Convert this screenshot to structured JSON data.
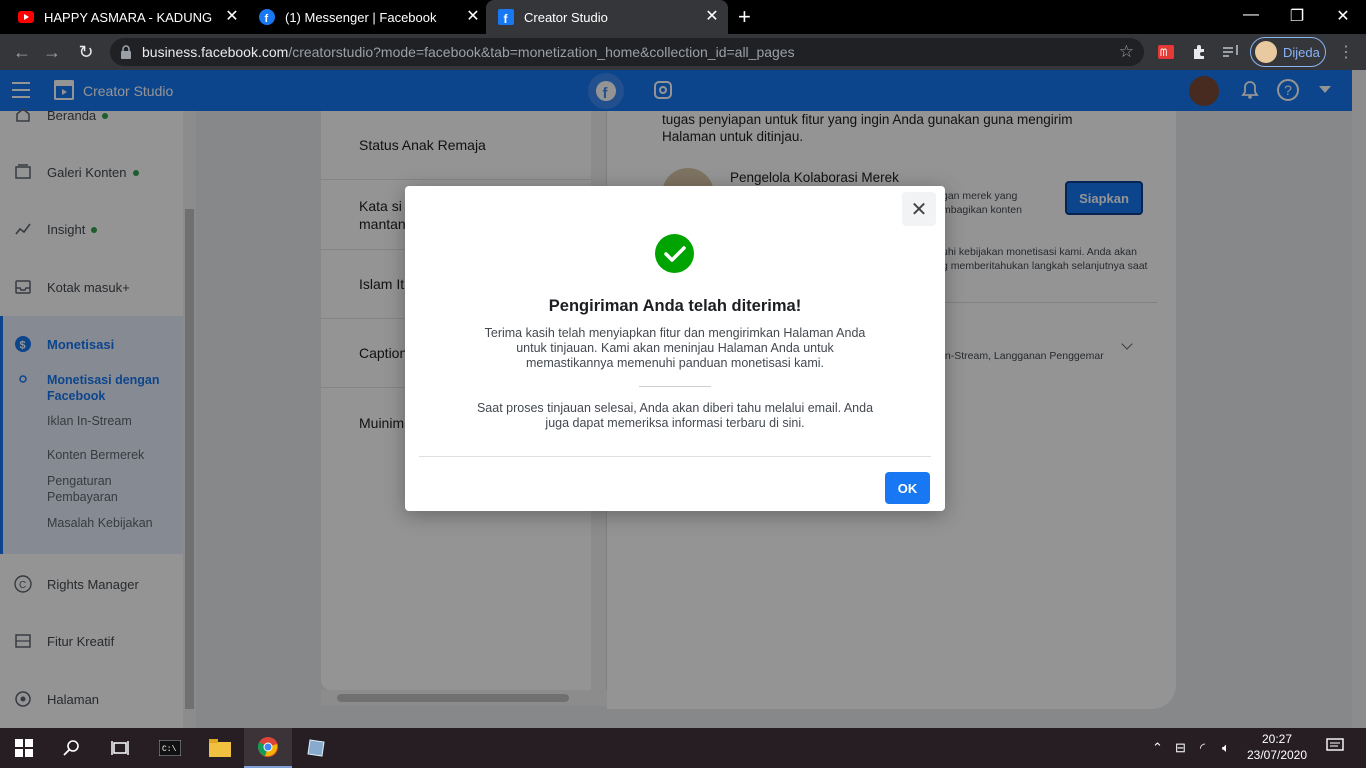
{
  "browser": {
    "tabs": [
      {
        "title": "HAPPY ASMARA - KADUNG JERU",
        "icon": "youtube-icon"
      },
      {
        "title": "(1) Messenger | Facebook",
        "icon": "facebook-icon"
      },
      {
        "title": "Creator Studio",
        "icon": "facebook-icon",
        "active": true
      }
    ],
    "url_host": "business.facebook.com",
    "url_path": "/creatorstudio?mode=facebook&tab=monetization_home&collection_id=all_pages",
    "profile_name": "Dijeda"
  },
  "app": {
    "brand": "Creator Studio"
  },
  "sidebar": {
    "items": [
      {
        "label": "Beranda",
        "dot": true,
        "icon": "home-icon"
      },
      {
        "label": "Galeri Konten",
        "dot": true,
        "icon": "gallery-icon"
      },
      {
        "label": "Insight",
        "dot": true,
        "icon": "insight-icon"
      },
      {
        "label": "Kotak masuk+",
        "icon": "inbox-icon"
      },
      {
        "label": "Monetisasi",
        "icon": "dollar-icon"
      },
      {
        "label": "Rights Manager",
        "icon": "copyright-icon"
      },
      {
        "label": "Fitur Kreatif",
        "icon": "creative-icon"
      },
      {
        "label": "Halaman",
        "icon": "pages-icon"
      }
    ],
    "sub_items": [
      {
        "label": "Monetisasi dengan Facebook",
        "selected": true
      },
      {
        "label": "Iklan In-Stream"
      },
      {
        "label": "Konten Bermerek"
      },
      {
        "label": "Pengaturan Pembayaran"
      },
      {
        "label": "Masalah Kebijakan"
      }
    ]
  },
  "pages_list": [
    "Status Anak Remaja",
    "Kata si\nmantan",
    "Islam It",
    "Caption",
    "Muinim"
  ],
  "content": {
    "intro": "tugas penyiapan untuk fitur yang ingin Anda gunakan guna mengirim Halaman untuk ditinjau.",
    "feature_title": "Pengelola Kolaborasi Merek",
    "feature_desc_1": "gan merek yang",
    "feature_desc_2": "mbagikan konten",
    "setup_button": "Siapkan",
    "policy_1": "uhi kebijakan monetisasi kami. Anda akan",
    "policy_2": "g memberitahukan langkah selanjutnya saat",
    "features_row": "In-Stream, Langganan Penggemar"
  },
  "modal": {
    "title": "Pengiriman Anda telah diterima!",
    "body1": "Terima kasih telah menyiapkan fitur dan mengirimkan Halaman Anda untuk tinjauan. Kami akan meninjau Halaman Anda untuk memastikannya memenuhi panduan monetisasi kami.",
    "body2": "Saat proses tinjauan selesai, Anda akan diberi tahu melalui email. Anda juga dapat memeriksa informasi terbaru di sini.",
    "ok_label": "OK",
    "close_icon": "close-icon",
    "success_color": "#00a400",
    "accent": "#1877f2"
  },
  "taskbar": {
    "time": "20:27",
    "date": "23/07/2020"
  }
}
